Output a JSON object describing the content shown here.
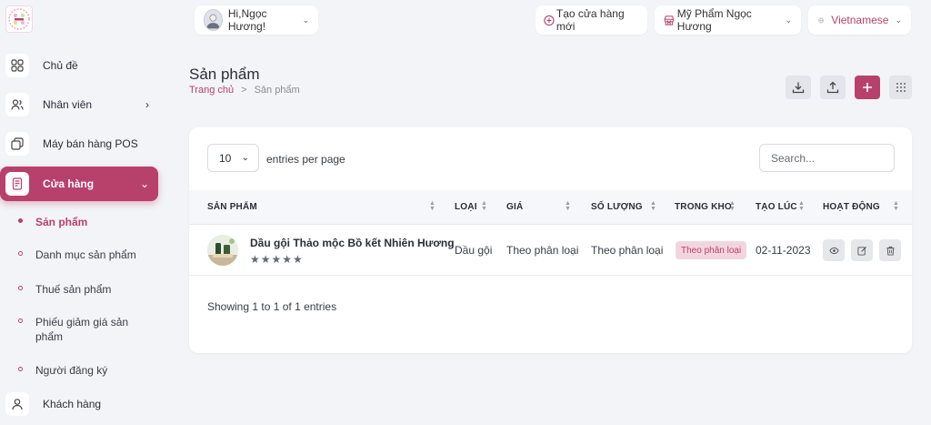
{
  "user": {
    "greeting": "Hi,Ngọc Hương!"
  },
  "topbar": {
    "create_store": "Tạo cửa hàng mới",
    "store_name": "Mỹ Phẩm Ngọc Hương",
    "language": "Vietnamese"
  },
  "sidebar": {
    "items": [
      {
        "label": "Chủ đề",
        "icon": "grid-icon"
      },
      {
        "label": "Nhân viên",
        "icon": "users-icon"
      },
      {
        "label": "Máy bán hàng POS",
        "icon": "copy-icon"
      },
      {
        "label": "Cửa hàng",
        "icon": "store-icon"
      },
      {
        "label": "Khách hàng",
        "icon": "user-icon"
      }
    ],
    "subitems": [
      {
        "label": "Sản phẩm"
      },
      {
        "label": "Danh mục sản phẩm"
      },
      {
        "label": "Thuế sản phẩm"
      },
      {
        "label": "Phiếu giảm giá sản phẩm"
      },
      {
        "label": "Người đăng ký"
      }
    ]
  },
  "page": {
    "title": "Sản phẩm",
    "breadcrumb_home": "Trang chủ",
    "breadcrumb_sep": ">",
    "breadcrumb_current": "Sản phẩm"
  },
  "table": {
    "per_page_value": "10",
    "per_page_label": "entries per page",
    "search_placeholder": "Search...",
    "columns": [
      "SẢN PHẨM",
      "LOẠI",
      "GIÁ",
      "SỐ LƯỢNG",
      "TRONG KHO",
      "TẠO LÚC",
      "HOẠT ĐỘNG"
    ],
    "rows": [
      {
        "name": "Dầu gội Thảo mộc Bồ kết Nhiên Hương",
        "rating": "★★★★★",
        "type": "Dầu gội",
        "price": "Theo phân loại",
        "quantity": "Theo phân loại",
        "stock": "Theo phân loại",
        "created": "02-11-2023"
      }
    ],
    "info": "Showing 1 to 1 of 1 entries"
  },
  "colors": {
    "accent": "#b8416b",
    "background": "#f3f4f7"
  }
}
